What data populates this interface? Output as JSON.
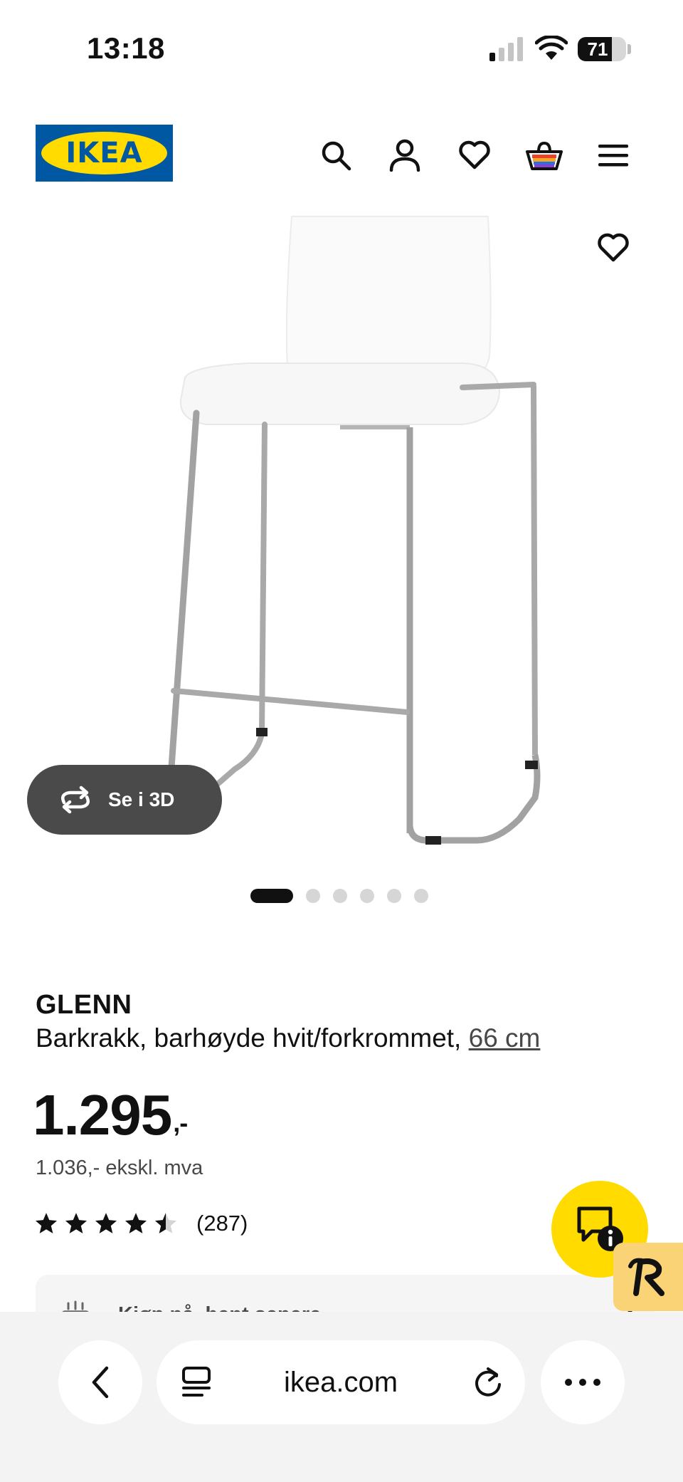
{
  "status_bar": {
    "time": "13:18",
    "battery_percent": "71"
  },
  "header": {
    "logo_text": "IKEA",
    "icons": [
      "search-icon",
      "account-icon",
      "wishlist-icon",
      "basket-icon",
      "menu-icon"
    ]
  },
  "gallery": {
    "view_3d_label": "Se i 3D",
    "image_count": 6,
    "active_index": 0
  },
  "product": {
    "name": "GLENN",
    "description": "Barkrakk, barhøyde hvit/forkrommet,",
    "size": "66 cm",
    "price": "1.295",
    "price_suffix": ",-",
    "price_ex_vat": "1.036,- ekskl. mva",
    "rating": 4.5,
    "review_count": "(287)"
  },
  "pickup_banner": {
    "label": "Kjøp nå, hent senere"
  },
  "browser": {
    "url": "ikea.com"
  },
  "colors": {
    "ikea_blue": "#0058A3",
    "ikea_yellow": "#FFDB00",
    "badge_bg": "#F9D376"
  }
}
